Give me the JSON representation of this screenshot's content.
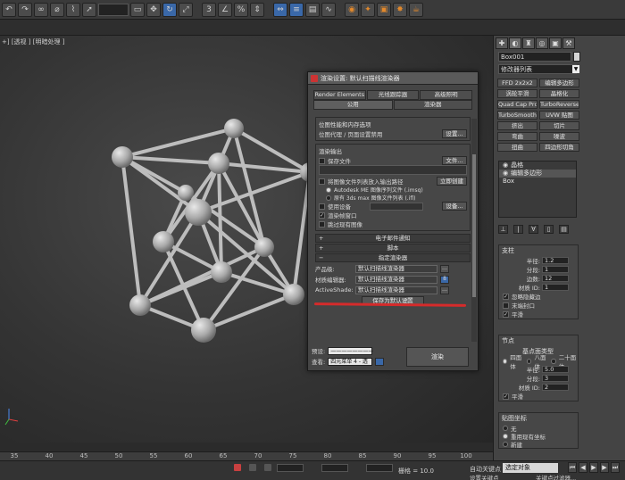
{
  "toolbar": {
    "icons": [
      "undo-icon",
      "redo-icon",
      "link-icon",
      "unlink-icon",
      "bind-icon",
      "select-icon",
      "select-region-icon",
      "move-icon",
      "rotate-icon",
      "scale-icon",
      "snap-icon",
      "angle-snap-icon",
      "percent-snap-icon",
      "spinner-snap-icon",
      "mirror-icon",
      "align-icon",
      "layer-icon",
      "curve-editor-icon",
      "schematic-icon",
      "material-editor-icon",
      "render-setup-icon",
      "render-frame-icon",
      "render-icon",
      "teapot-icon"
    ]
  },
  "viewport": {
    "label": "+] [透视 ] [明暗处理 ]"
  },
  "timeline": {
    "ticks": [
      "35",
      "40",
      "45",
      "50",
      "55",
      "60",
      "65",
      "70",
      "75",
      "80",
      "85",
      "90",
      "95",
      "100"
    ]
  },
  "status": {
    "grid": "栅格 = 10.0",
    "auto_key": "自动关键点",
    "set_key": "设置关键点",
    "selection": "选定对象",
    "filter": "关键点过滤器..."
  },
  "command_panel": {
    "object_name": "Box001",
    "object_color": "#d4d4d4",
    "modifier_list": "修改器列表",
    "modifier_buttons": [
      "FFD 2x2x2",
      "编辑多边形",
      "涡轮平滑",
      "晶格化",
      "Quad Cap Pro",
      "TurboReverse",
      "TurboSmooth Pro",
      "UVW 贴图",
      "挤出",
      "切片",
      "弯曲",
      "噪波",
      "扭曲",
      "四边形切角"
    ],
    "stack": [
      "晶格",
      "编辑多边形",
      "Box"
    ],
    "struts": {
      "title": "支柱",
      "radius_label": "半径:",
      "radius": "1.2",
      "segments_label": "分段:",
      "segments": "1",
      "sides_label": "边数:",
      "sides": "12",
      "material_label": "材质 ID:",
      "material": "1",
      "ignore_hidden": "忽略隐藏边",
      "end_caps": "末端封口",
      "smooth": "平滑"
    },
    "joints": {
      "title": "节点",
      "type_label": "基点面类型",
      "tetra": "四面体",
      "octa": "八面体",
      "icosa": "二十面体",
      "radius_label": "半径:",
      "radius": "5.0",
      "segments_label": "分段:",
      "segments": "3",
      "material_label": "材质 ID:",
      "material": "2",
      "smooth": "平滑"
    },
    "mapping": {
      "title": "贴图坐标",
      "none": "无",
      "reuse": "重用现有坐标",
      "new": "新建"
    }
  },
  "dialog": {
    "title": "渲染设置: 默认扫描线渲染器",
    "tabs_row1": [
      "Render Elements",
      "光线跟踪器",
      "高级照明"
    ],
    "tabs_row2": [
      "公用",
      "渲染器"
    ],
    "bitmap_group_title": "位图性能和内存选项",
    "bitmap_text": "位图代理 / 页面设置禁用",
    "setup_button": "设置...",
    "output_group_title": "渲染输出",
    "save_file": "保存文件",
    "files_button": "文件...",
    "put_image": "将图像文件列表放入输出路径",
    "create_now": "立即创建",
    "autodesk_mi": "Autodesk ME 图像序列文件 (.imsq)",
    "legacy_list": "原有 3ds max 图像文件列表 (.ifl)",
    "use_device": "使用设备",
    "device_button": "设备...",
    "render_frame_window": "渲染帧窗口",
    "skip_existing": "跳过现有图像",
    "rollout_email": "电子邮件通知",
    "rollout_script": "脚本",
    "rollout_assign": "指定渲染器",
    "production_label": "产品级:",
    "production_value": "默认扫描线渲染器",
    "material_editor_label": "材质编辑器:",
    "material_editor_value": "默认扫描线渲染器",
    "activeshade_label": "ActiveShade:",
    "activeshade_value": "默认扫描线渲染器",
    "save_default": "保存为默认设置",
    "preset_label": "预设:",
    "preset_value": "————————",
    "view_label": "查看:",
    "view_value": "四元菜单 4 - 透",
    "render_button": "渲染"
  }
}
